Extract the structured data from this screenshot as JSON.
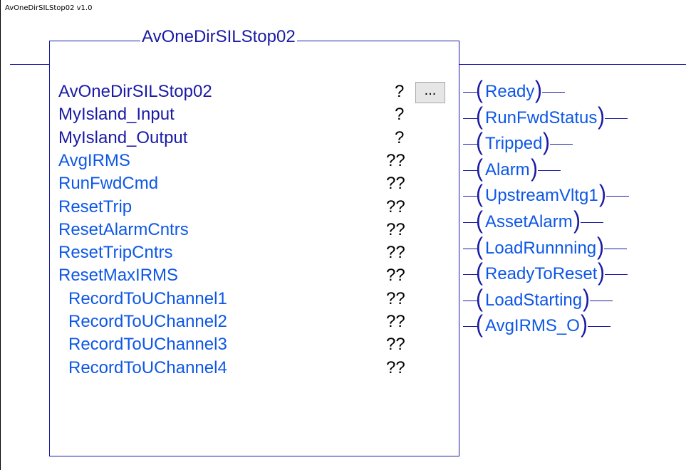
{
  "instruction": {
    "version_label": "AvOneDirSILStop02 v1.0",
    "block_name": "AvOneDirSILStop02",
    "ellipsis_label": "..."
  },
  "parameters": [
    {
      "name": "AvOneDirSILStop02",
      "value": "?"
    },
    {
      "name": "MyIsland_Input",
      "value": "?"
    },
    {
      "name": "MyIsland_Output",
      "value": "?"
    },
    {
      "name": "AvgIRMS",
      "value": "??"
    },
    {
      "name": "RunFwdCmd",
      "value": "??"
    },
    {
      "name": "ResetTrip",
      "value": "??"
    },
    {
      "name": "ResetAlarmCntrs",
      "value": "??"
    },
    {
      "name": "ResetTripCntrs",
      "value": "??"
    },
    {
      "name": "ResetMaxIRMS",
      "value": "??"
    },
    {
      "name": "RecordToUChannel1",
      "value": "??"
    },
    {
      "name": "RecordToUChannel2",
      "value": "??"
    },
    {
      "name": "RecordToUChannel3",
      "value": "??"
    },
    {
      "name": "RecordToUChannel4",
      "value": "??"
    }
  ],
  "outputs": [
    {
      "tag": "Ready"
    },
    {
      "tag": "RunFwdStatus"
    },
    {
      "tag": "Tripped"
    },
    {
      "tag": "Alarm"
    },
    {
      "tag": "UpstreamVltg1"
    },
    {
      "tag": "AssetAlarm"
    },
    {
      "tag": "LoadRunnning"
    },
    {
      "tag": "ReadyToReset"
    },
    {
      "tag": "LoadStarting"
    },
    {
      "tag": "AvgIRMS_O"
    }
  ],
  "colors": {
    "wire": "#1a1aa6",
    "inout_param": "#1a1aa6",
    "input_param": "#0d57e6",
    "output_tag": "#0d57e6"
  }
}
